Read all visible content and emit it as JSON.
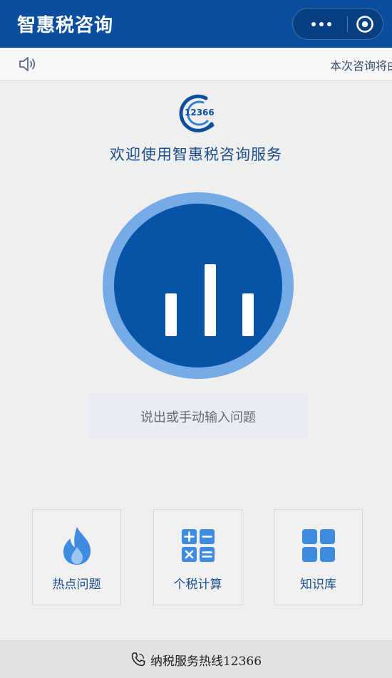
{
  "app": {
    "title": "智惠税咨询"
  },
  "notice": {
    "text": "本次咨询将由智能机器人为您解答"
  },
  "logo": {
    "number": "12366"
  },
  "welcome": {
    "text": "欢迎使用智惠税咨询服务"
  },
  "input": {
    "placeholder": "说出或手动输入问题"
  },
  "tiles": [
    {
      "label": "热点问题",
      "icon": "flame-icon"
    },
    {
      "label": "个税计算",
      "icon": "calculator-icon"
    },
    {
      "label": "知识库",
      "icon": "grid-icon"
    }
  ],
  "footer": {
    "hotline": "纳税服务热线12366"
  },
  "colors": {
    "brand": "#0a4ea0",
    "mic_outer": "#75abe6",
    "mic_inner": "#0753a6",
    "tile_icon": "#3f8be0"
  }
}
